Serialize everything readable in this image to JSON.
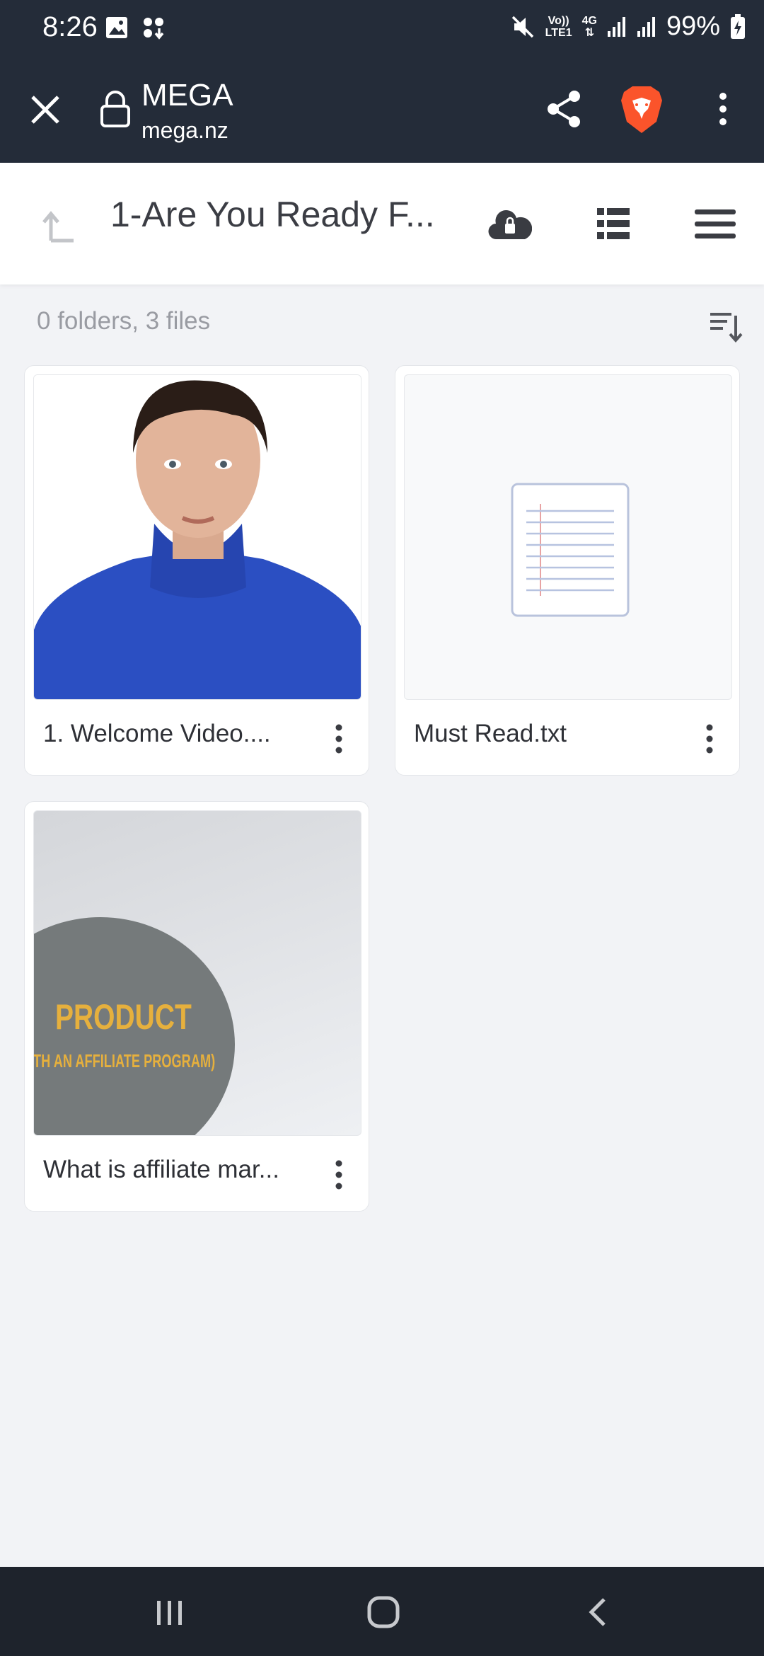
{
  "status_bar": {
    "time": "8:26",
    "network_top": "Vo))",
    "network_bottom": "LTE1",
    "net_type": "4G",
    "battery": "99%"
  },
  "browser": {
    "site_title": "MEGA",
    "site_url": "mega.nz"
  },
  "header": {
    "folder_title": "1-Are You Ready F..."
  },
  "summary": "0 folders, 3 files",
  "files": [
    {
      "name": "1. Welcome Video...."
    },
    {
      "name": "Must Read.txt"
    },
    {
      "name": "What is affiliate mar..."
    }
  ],
  "thumbnail3": {
    "line1": "PRODUCT",
    "line2": "ITH AN AFFILIATE PROGRAM)"
  },
  "colors": {
    "top_bar": "#242c39",
    "background": "#f2f3f6",
    "brave_orange": "#fb542b",
    "sweater_blue": "#2b4fc2"
  },
  "icons": [
    "close-icon",
    "lock-icon",
    "share-icon",
    "brave-icon",
    "more-vert-icon",
    "up-arrow-icon",
    "cloud-lock-icon",
    "list-view-icon",
    "hamburger-icon",
    "sort-icon",
    "text-file-icon",
    "recents-icon",
    "home-icon",
    "back-icon"
  ]
}
